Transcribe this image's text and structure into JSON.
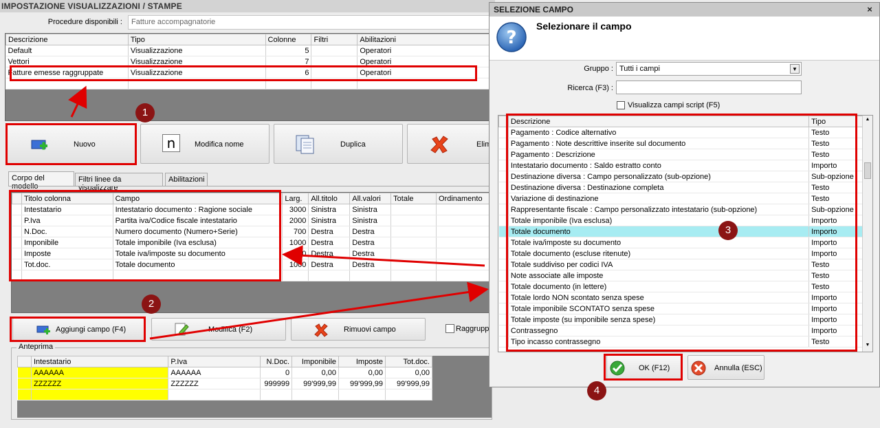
{
  "main": {
    "title": "IMPOSTAZIONE VISUALIZZAZIONI / STAMPE",
    "procedure_label": "Procedure disponibili :",
    "procedure_value": "Fatture accompagnatorie",
    "top_grid": {
      "headers": [
        "Descrizione",
        "Tipo",
        "Colonne",
        "Filtri",
        "Abilitazioni"
      ],
      "rows": [
        [
          "Default",
          "Visualizzazione",
          "5",
          "",
          "Operatori"
        ],
        [
          "Vettori",
          "Visualizzazione",
          "7",
          "",
          "Operatori"
        ],
        [
          "Fatture emesse raggruppate",
          "Visualizzazione",
          "6",
          "",
          "Operatori"
        ]
      ]
    },
    "toolbar": {
      "nuovo": "Nuovo",
      "modifica_nome": "Modifica nome",
      "duplica": "Duplica",
      "elimina": "Elimi"
    },
    "tabs": [
      "Corpo del modello",
      "Filtri linee da visualizzare",
      "Abilitazioni"
    ],
    "fields_grid": {
      "headers": [
        "Titolo colonna",
        "Campo",
        "Larg.",
        "All.titolo",
        "All.valori",
        "Totale",
        "Ordinamento"
      ],
      "rows": [
        [
          "Intestatario",
          "Intestatario documento : Ragione sociale",
          "3000",
          "Sinistra",
          "Sinistra",
          "",
          ""
        ],
        [
          "P.Iva",
          "Partita iva/Codice fiscale intestatario",
          "2000",
          "Sinistra",
          "Sinistra",
          "",
          ""
        ],
        [
          "N.Doc.",
          "Numero documento (Numero+Serie)",
          "700",
          "Destra",
          "Destra",
          "",
          ""
        ],
        [
          "Imponibile",
          "Totale imponibile (Iva esclusa)",
          "1000",
          "Destra",
          "Destra",
          "",
          ""
        ],
        [
          "Imposte",
          "Totale iva/imposte su documento",
          "1000",
          "Destra",
          "Destra",
          "",
          ""
        ],
        [
          "Tot.doc.",
          "Totale documento",
          "1000",
          "Destra",
          "Destra",
          "",
          ""
        ]
      ]
    },
    "field_buttons": {
      "aggiungi": "Aggiungi campo (F4)",
      "modifica": "Modifica (F2)",
      "rimuovi": "Rimuovi campo",
      "raggruppa": "Raggrupp"
    },
    "preview": {
      "legend": "Anteprima",
      "headers": [
        "Intestatario",
        "P.Iva",
        "N.Doc.",
        "Imponibile",
        "Imposte",
        "Tot.doc."
      ],
      "rows": [
        [
          "AAAAAA",
          "AAAAAA",
          "0",
          "0,00",
          "0,00",
          "0,00"
        ],
        [
          "ZZZZZZ",
          "ZZZZZZ",
          "999999",
          "99'999,99",
          "99'999,99",
          "99'999,99"
        ]
      ]
    }
  },
  "dialog": {
    "title": "SELEZIONE CAMPO",
    "close": "×",
    "heading": "Selezionare il campo",
    "gruppo_label": "Gruppo :",
    "gruppo_value": "Tutti i campi",
    "ricerca_label": "Ricerca (F3) :",
    "ricerca_value": "",
    "script_checkbox": "Visualizza campi script (F5)",
    "list_headers": [
      "Descrizione",
      "Tipo"
    ],
    "list_rows": [
      [
        "Pagamento : Codice alternativo",
        "Testo"
      ],
      [
        "Pagamento : Note descrittive inserite sul documento",
        "Testo"
      ],
      [
        "Pagamento : Descrizione",
        "Testo"
      ],
      [
        "Intestatario documento : Saldo estratto conto",
        "Importo"
      ],
      [
        "Destinazione diversa : Campo personalizzato (sub-opzione)",
        "Sub-opzione"
      ],
      [
        "Destinazione diversa : Destinazione completa",
        "Testo"
      ],
      [
        "Variazione di destinazione",
        "Testo"
      ],
      [
        "Rappresentante fiscale : Campo personalizzato intestatario (sub-opzione)",
        "Sub-opzione"
      ],
      [
        "Totale imponibile (Iva esclusa)",
        "Importo"
      ],
      [
        "Totale documento",
        "Importo"
      ],
      [
        "Totale iva/imposte su documento",
        "Importo"
      ],
      [
        "Totale documento (escluse ritenute)",
        "Importo"
      ],
      [
        "Totale suddiviso per codici IVA",
        "Testo"
      ],
      [
        "Note associate alle imposte",
        "Testo"
      ],
      [
        "Totale documento (in lettere)",
        "Testo"
      ],
      [
        "Totale lordo NON scontato senza spese",
        "Importo"
      ],
      [
        "Totale imponibile SCONTATO senza spese",
        "Importo"
      ],
      [
        "Totale imposte (su imponibile senza spese)",
        "Importo"
      ],
      [
        "Contrassegno",
        "Importo"
      ],
      [
        "Tipo incasso contrassegno",
        "Testo"
      ]
    ],
    "selected_row": 9,
    "ok": "OK (F12)",
    "annulla": "Annulla (ESC)"
  },
  "annotations": [
    "1",
    "2",
    "3",
    "4"
  ],
  "colors": {
    "annotation_red": "#e00000",
    "badge": "#8b1414",
    "selected_row": "#a7ecf2",
    "preview_highlight": "#ffff00"
  }
}
